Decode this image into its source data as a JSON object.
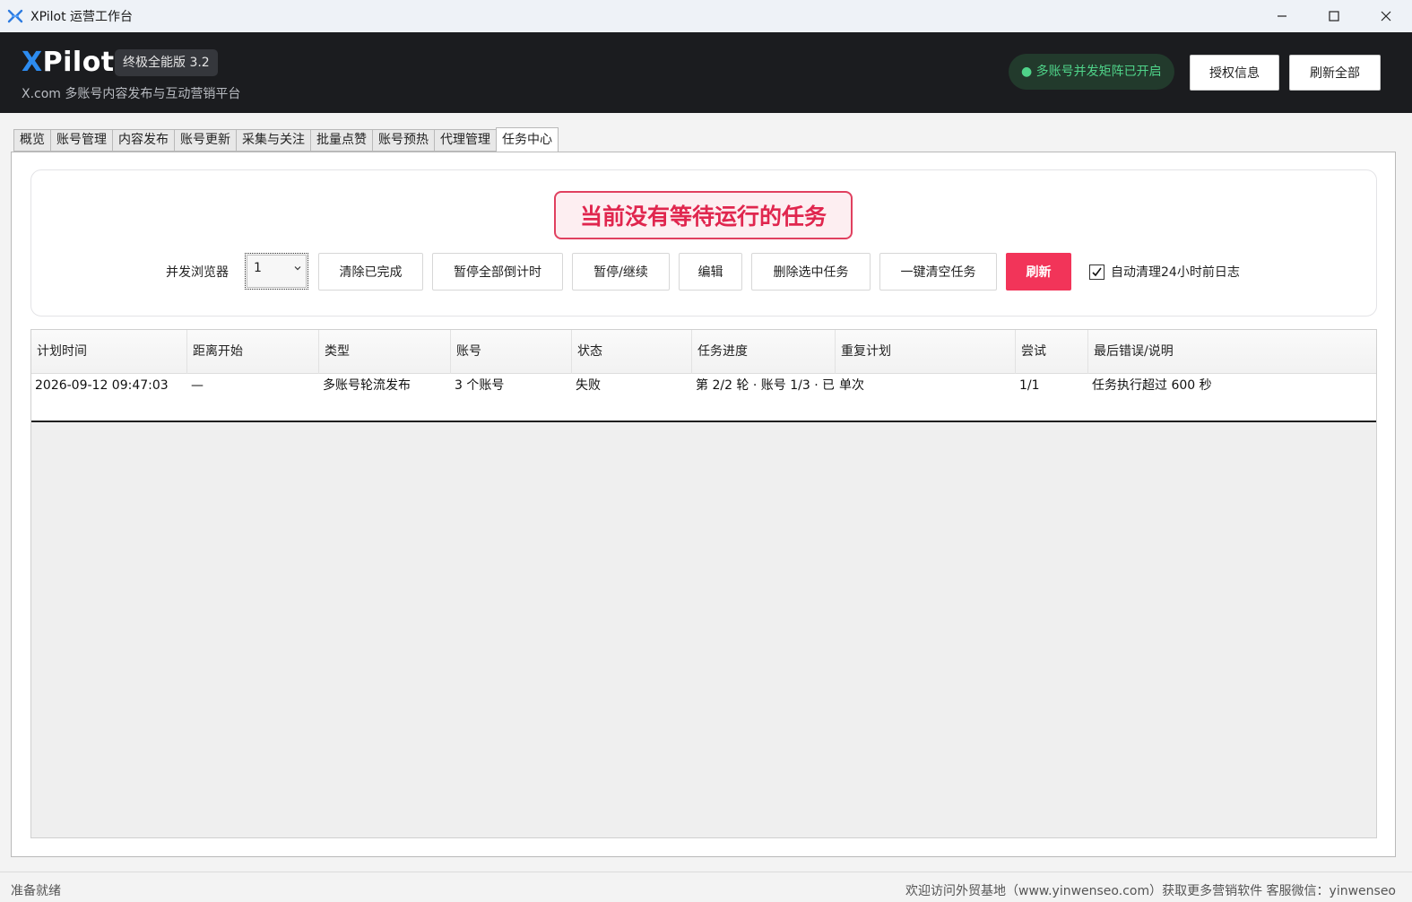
{
  "window": {
    "title": "XPilot 运营工作台",
    "minimize": "—",
    "maximize": "☐",
    "close": "✕"
  },
  "header": {
    "brand_x": "X",
    "brand_rest": "Pilot",
    "version": "终极全能版 3.2",
    "subtitle": "X.com 多账号内容发布与互动营销平台",
    "status": "● 多账号并发矩阵已开启",
    "auth_button": "授权信息",
    "refresh_all_button": "刷新全部",
    "colors": {
      "brand_accent": "#2d8cf0",
      "status_green": "#4fd389"
    }
  },
  "tabs": [
    {
      "label": "概览"
    },
    {
      "label": "账号管理"
    },
    {
      "label": "内容发布"
    },
    {
      "label": "账号更新"
    },
    {
      "label": "采集与关注"
    },
    {
      "label": "批量点赞"
    },
    {
      "label": "账号预热"
    },
    {
      "label": "代理管理"
    },
    {
      "label": "任务中心"
    }
  ],
  "active_tab": "任务中心",
  "task_center": {
    "banner": "当前没有等待运行的任务",
    "concurrency_label": "并发浏览器",
    "concurrency_value": "1",
    "buttons": {
      "clear_completed": "清除已完成",
      "pause_all_countdown": "暂停全部倒计时",
      "pause_resume": "暂停/继续",
      "edit": "编辑",
      "delete_selected": "删除选中任务",
      "clear_all": "一键清空任务",
      "refresh": "刷新"
    },
    "auto_clean_label": "自动清理24小时前日志",
    "auto_clean_checked": true,
    "accent_color": "#f23459"
  },
  "table": {
    "columns": [
      "计划时间",
      "距离开始",
      "类型",
      "账号",
      "状态",
      "任务进度",
      "重复计划",
      "尝试",
      "最后错误/说明"
    ],
    "rows": [
      {
        "scheduled": "2026-09-12 09:47:03",
        "countdown": "—",
        "type": "多账号轮流发布",
        "accounts": "3 个账号",
        "status": "失败",
        "progress": "第 2/2 轮 · 账号 1/3 · 已",
        "repeat": "单次",
        "attempts": "1/1",
        "error": "任务执行超过 600 秒"
      }
    ]
  },
  "statusbar": {
    "left": "准备就绪",
    "right": "欢迎访问外贸基地（www.yinwenseo.com）获取更多营销软件    客服微信：yinwenseo"
  }
}
